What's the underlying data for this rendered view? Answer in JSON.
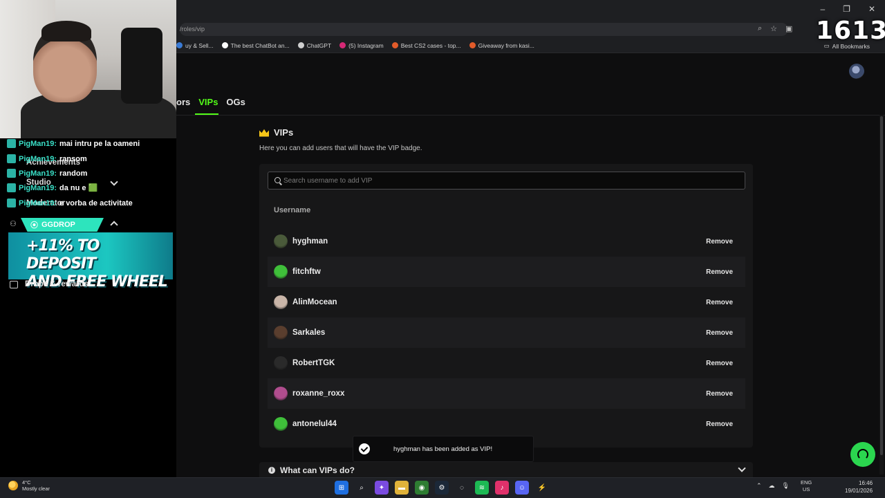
{
  "browser": {
    "url": "/roles/vip",
    "bookmarks": [
      {
        "label": "uy & Sell...",
        "color": "#3a7bd5"
      },
      {
        "label": "The best ChatBot an...",
        "color": "#ffffff"
      },
      {
        "label": "ChatGPT",
        "color": "#cfcfcf"
      },
      {
        "label": "(5) Instagram",
        "color": "#d62976"
      },
      {
        "label": "Best CS2 cases - top...",
        "color": "#e25b2a"
      },
      {
        "label": "Giveaway from kasi...",
        "color": "#e25b2a"
      }
    ],
    "all_bookmarks_label": "All Bookmarks",
    "window_controls": [
      "–",
      "❐",
      "✕"
    ]
  },
  "stream": {
    "counter": "1613",
    "chat": [
      {
        "nick": "PigMan19:",
        "msg": "mai intru pe la oameni"
      },
      {
        "nick": "PigMan19:",
        "msg": "ransom"
      },
      {
        "nick": "PigMan19:",
        "msg": "random"
      },
      {
        "nick": "PigMan19:",
        "msg": "da nu e 🟩"
      },
      {
        "nick": "PigMan19:",
        "msg": "e vorba de activitate"
      }
    ],
    "ghost_sidebar": [
      "Achievements",
      "Studio",
      "Moderator"
    ],
    "ggdrop_tag": "GGDROP",
    "ggdrop_promo_line1": "+11% TO DEPOSIT",
    "ggdrop_promo_line2": "AND FREE WHEEL",
    "drops_label": "Drops & rewards"
  },
  "tabs": [
    {
      "label": "ors",
      "active": false
    },
    {
      "label": "VIPs",
      "active": true
    },
    {
      "label": "OGs",
      "active": false
    }
  ],
  "vips": {
    "title": "VIPs",
    "description": "Here you can add users that will have the VIP badge.",
    "search_placeholder": "Search username to add VIP",
    "column_header": "Username",
    "remove_label": "Remove",
    "users": [
      {
        "name": "hyghman",
        "avatar": "#4a5a3a"
      },
      {
        "name": "fitchftw",
        "avatar": "#3fbf3a"
      },
      {
        "name": "AlinMocean",
        "avatar": "#c9b5a8"
      },
      {
        "name": "Sarkales",
        "avatar": "#5a3e2e"
      },
      {
        "name": "RobertTGK",
        "avatar": "#2a2a2a"
      },
      {
        "name": "roxanne_roxx",
        "avatar": "#b04d8e"
      },
      {
        "name": "antonelul44",
        "avatar": "#3fbf3a"
      }
    ]
  },
  "toast": {
    "text": "hyghman has been added as VIP!"
  },
  "faq": {
    "title": "What can VIPs do?"
  },
  "taskbar": {
    "temperature": "4°C",
    "weather": "Mostly clear",
    "lang_top": "ENG",
    "lang_bottom": "US",
    "time": "16:46",
    "date": "19/01/2026"
  }
}
